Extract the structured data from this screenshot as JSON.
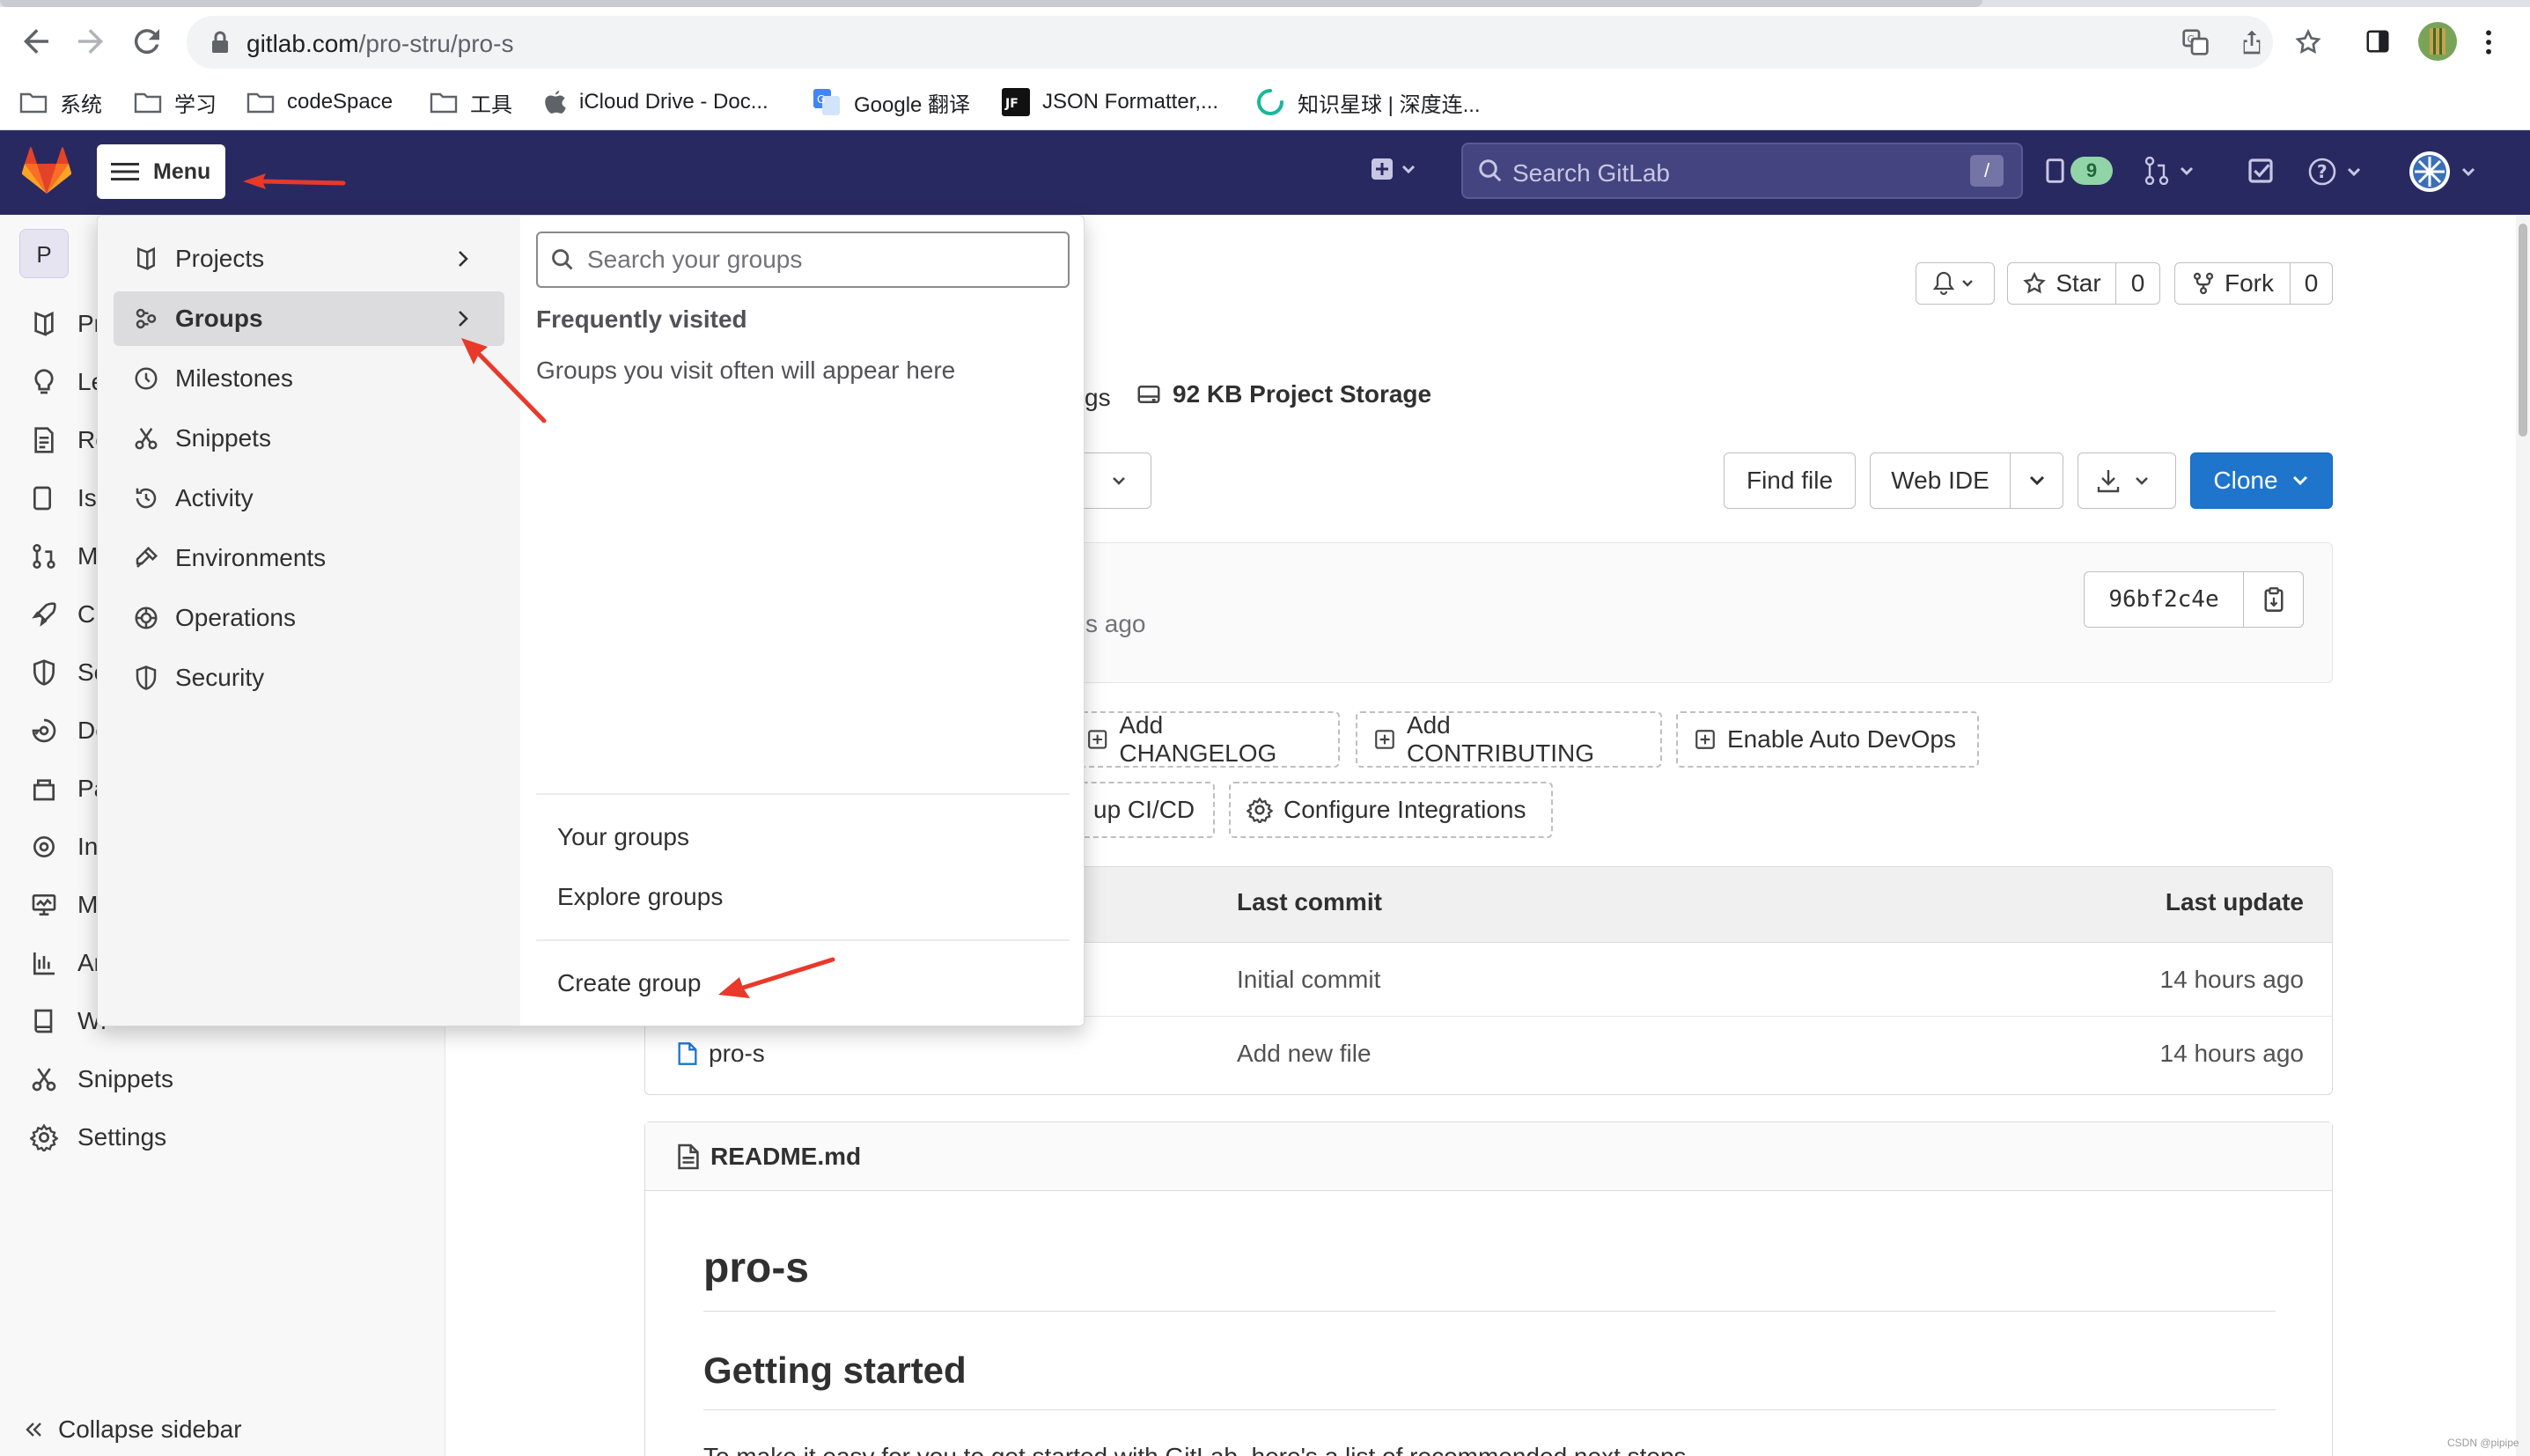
{
  "browser": {
    "url_host": "gitlab.com",
    "url_path": "/pro-stru/pro-s",
    "bookmarks": [
      {
        "label": "系统",
        "icon": "folder-icon"
      },
      {
        "label": "学习",
        "icon": "folder-icon"
      },
      {
        "label": "codeSpace",
        "icon": "folder-icon"
      },
      {
        "label": "工具",
        "icon": "folder-icon"
      },
      {
        "label": "iCloud Drive - Doc...",
        "icon": "apple-icon"
      },
      {
        "label": "Google 翻译",
        "icon": "google-translate-icon"
      },
      {
        "label": "JSON Formatter,...",
        "icon": "jf-icon"
      },
      {
        "label": "知识星球 | 深度连...",
        "icon": "zsxq-icon"
      }
    ]
  },
  "gitlab_nav": {
    "menu_label": "Menu",
    "search_placeholder": "Search GitLab",
    "search_shortcut": "/",
    "issues_badge": "9"
  },
  "sidebar": {
    "project_initial": "P",
    "items": [
      {
        "label": "Pr",
        "icon": "project-icon"
      },
      {
        "label": "Le",
        "icon": "bulb-icon"
      },
      {
        "label": "Re",
        "icon": "repository-icon"
      },
      {
        "label": "Iss",
        "icon": "issues-icon"
      },
      {
        "label": "M",
        "icon": "merge-request-icon"
      },
      {
        "label": "CI",
        "icon": "rocket-icon"
      },
      {
        "label": "Se",
        "icon": "shield-icon"
      },
      {
        "label": "De",
        "icon": "deployments-icon"
      },
      {
        "label": "Pa",
        "icon": "package-icon"
      },
      {
        "label": "Inf",
        "icon": "cloud-gear-icon"
      },
      {
        "label": "M",
        "icon": "monitor-icon"
      },
      {
        "label": "Ar",
        "icon": "analytics-icon"
      },
      {
        "label": "Wi",
        "icon": "book-icon"
      },
      {
        "label": "Snippets",
        "icon": "snippet-icon"
      },
      {
        "label": "Settings",
        "icon": "settings-icon"
      }
    ],
    "collapse_label": "Collapse sidebar"
  },
  "menu": {
    "items": [
      {
        "label": "Projects",
        "icon": "project-icon",
        "has_submenu": true
      },
      {
        "label": "Groups",
        "icon": "group-icon",
        "has_submenu": true
      },
      {
        "label": "Milestones",
        "icon": "clock-icon",
        "has_submenu": false
      },
      {
        "label": "Snippets",
        "icon": "snippet-icon",
        "has_submenu": false
      },
      {
        "label": "Activity",
        "icon": "history-icon",
        "has_submenu": false
      },
      {
        "label": "Environments",
        "icon": "environment-icon",
        "has_submenu": false
      },
      {
        "label": "Operations",
        "icon": "operations-icon",
        "has_submenu": false
      },
      {
        "label": "Security",
        "icon": "shield-icon",
        "has_submenu": false
      }
    ],
    "active_item": "Groups",
    "groups_panel": {
      "search_placeholder": "Search your groups",
      "frequent_title": "Frequently visited",
      "frequent_empty": "Groups you visit often will appear here",
      "your_groups": "Your groups",
      "explore_groups": "Explore groups",
      "create_group": "Create group"
    }
  },
  "project": {
    "star_label": "Star",
    "star_count": "0",
    "fork_label": "Fork",
    "fork_count": "0",
    "stats_fragment": "gs",
    "storage": "92 KB Project Storage",
    "find_file": "Find file",
    "web_ide": "Web IDE",
    "clone": "Clone",
    "commit_age_fragment": "s ago",
    "commit_sha": "96bf2c4e",
    "quick_actions_row1": [
      "Add CHANGELOG",
      "Add CONTRIBUTING",
      "Enable Auto DevOps"
    ],
    "quick_actions_row2": [
      "up CI/CD",
      "Configure Integrations"
    ],
    "table": {
      "col_last_commit": "Last commit",
      "col_last_update": "Last update",
      "rows": [
        {
          "name": "",
          "commit": "Initial commit",
          "updated": "14 hours ago"
        },
        {
          "name": "pro-s",
          "commit": "Add new file",
          "updated": "14 hours ago"
        }
      ]
    },
    "readme": {
      "filename": "README.md",
      "h1": "pro-s",
      "h2": "Getting started",
      "para": "To make it easy for you to get started with GitLab, here's a list of recommended next steps."
    }
  },
  "watermark": "CSDN @pipipe",
  "colors": {
    "gitlab_nav_bg": "#292961",
    "clone_blue": "#1f75cb",
    "annotation_red": "#e8392b"
  }
}
